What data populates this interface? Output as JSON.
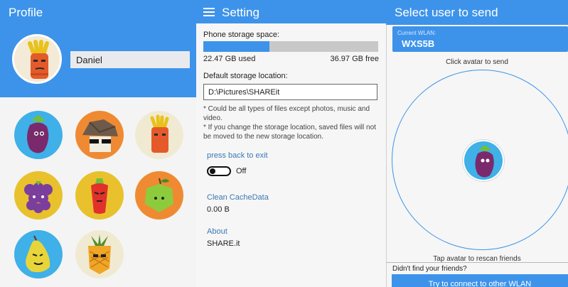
{
  "profile": {
    "title": "Profile",
    "username": "Daniel",
    "avatars": [
      "eggplant",
      "mushroom",
      "carrot",
      "grape",
      "chili",
      "apple",
      "pear",
      "pineapple"
    ]
  },
  "settings": {
    "title": "Setting",
    "storage_label": "Phone storage space:",
    "used_value": "22.47",
    "used_unit": "GB used",
    "free_value": "36.97",
    "free_unit": "GB free",
    "used_fraction": 0.38,
    "default_location_label": "Default storage location:",
    "path_value": "D:\\Pictures\\SHAREit",
    "note_1": "* Could be all types of files except photos, music and video.",
    "note_2": "* If you change the storage location, saved files will not be moved to the new storage location.",
    "press_back_label": "press back to exit",
    "toggle_state": "Off",
    "clean_cache_label": "Clean CacheData",
    "cache_value": "0.00",
    "cache_unit": "B",
    "about_label": "About",
    "about_value": "SHARE.it"
  },
  "send": {
    "title": "Select user to send",
    "wlan_label": "Current WLAN:",
    "wlan_name": "WXS5B",
    "click_hint": "Click avatar to send",
    "rescan_hint": "Tap avatar to rescan friends",
    "not_found": "Didn't find your friends?",
    "connect_button": "Try to connect to other WLAN"
  },
  "colors": {
    "accent": "#3d93ea",
    "link": "#3a78b5",
    "panel_bg": "#f6f6f6"
  },
  "icons": [
    "hamburger-menu-icon"
  ]
}
